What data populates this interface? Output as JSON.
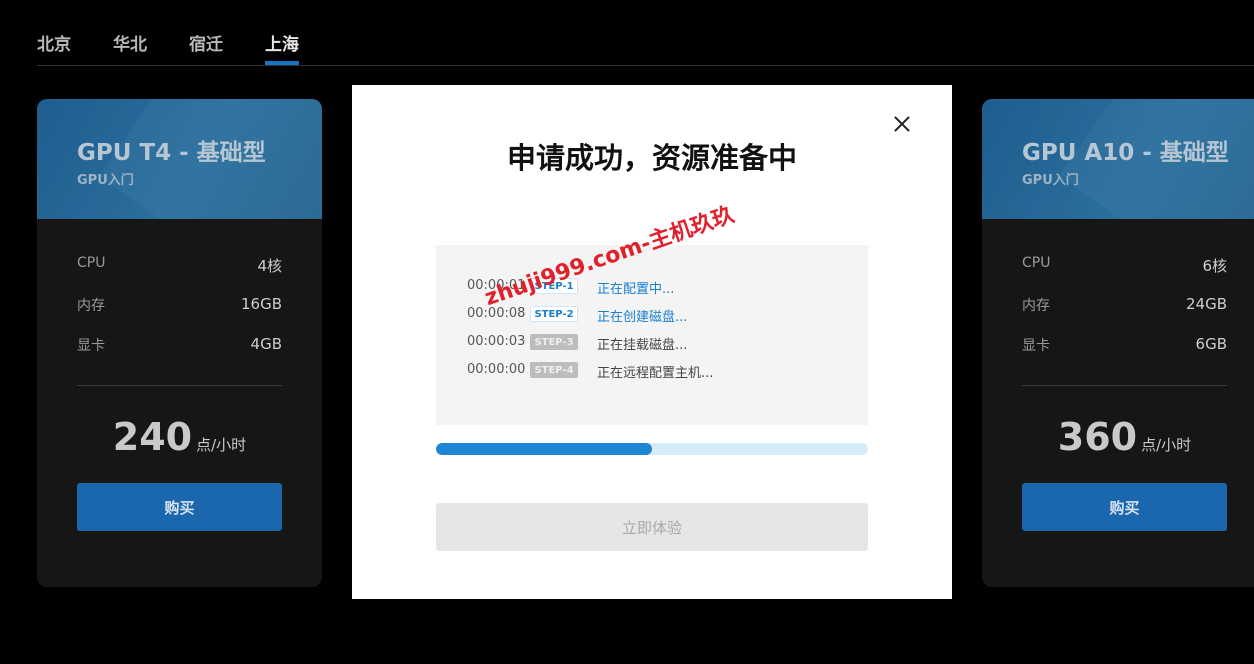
{
  "tabs": [
    {
      "label": "北京",
      "active": false
    },
    {
      "label": "华北",
      "active": false
    },
    {
      "label": "宿迁",
      "active": false
    },
    {
      "label": "上海",
      "active": true
    }
  ],
  "cards": [
    {
      "title": "GPU T4 - 基础型",
      "subtitle": "GPU入门",
      "specs": [
        {
          "key": "CPU",
          "value": "4核"
        },
        {
          "key": "内存",
          "value": "16GB"
        },
        {
          "key": "显卡",
          "value": "4GB"
        }
      ],
      "price": "240",
      "unit": "点/小时",
      "buy_label": "购买"
    },
    {
      "title": "GPU A10 - 基础型",
      "subtitle": "GPU入门",
      "specs": [
        {
          "key": "CPU",
          "value": "6核"
        },
        {
          "key": "内存",
          "value": "24GB"
        },
        {
          "key": "显卡",
          "value": "6GB"
        }
      ],
      "price": "360",
      "unit": "点/小时",
      "buy_label": "购买"
    }
  ],
  "modal": {
    "title": "申请成功，资源准备中",
    "steps": [
      {
        "time": "00:00:01",
        "badge": "STEP-1",
        "text": "正在配置中...",
        "done": true
      },
      {
        "time": "00:00:08",
        "badge": "STEP-2",
        "text": "正在创建磁盘...",
        "done": true
      },
      {
        "time": "00:00:03",
        "badge": "STEP-3",
        "text": "正在挂载磁盘...",
        "done": false
      },
      {
        "time": "00:00:00",
        "badge": "STEP-4",
        "text": "正在远程配置主机...",
        "done": false
      }
    ],
    "watermark": "zhuji999.com-主机玖玖",
    "progress_percent": 50,
    "try_label": "立即体验"
  },
  "colors": {
    "accent": "#1b67ad",
    "progress": "#1f86d6",
    "step_done": "#1a80d0",
    "watermark": "#e0202a"
  }
}
